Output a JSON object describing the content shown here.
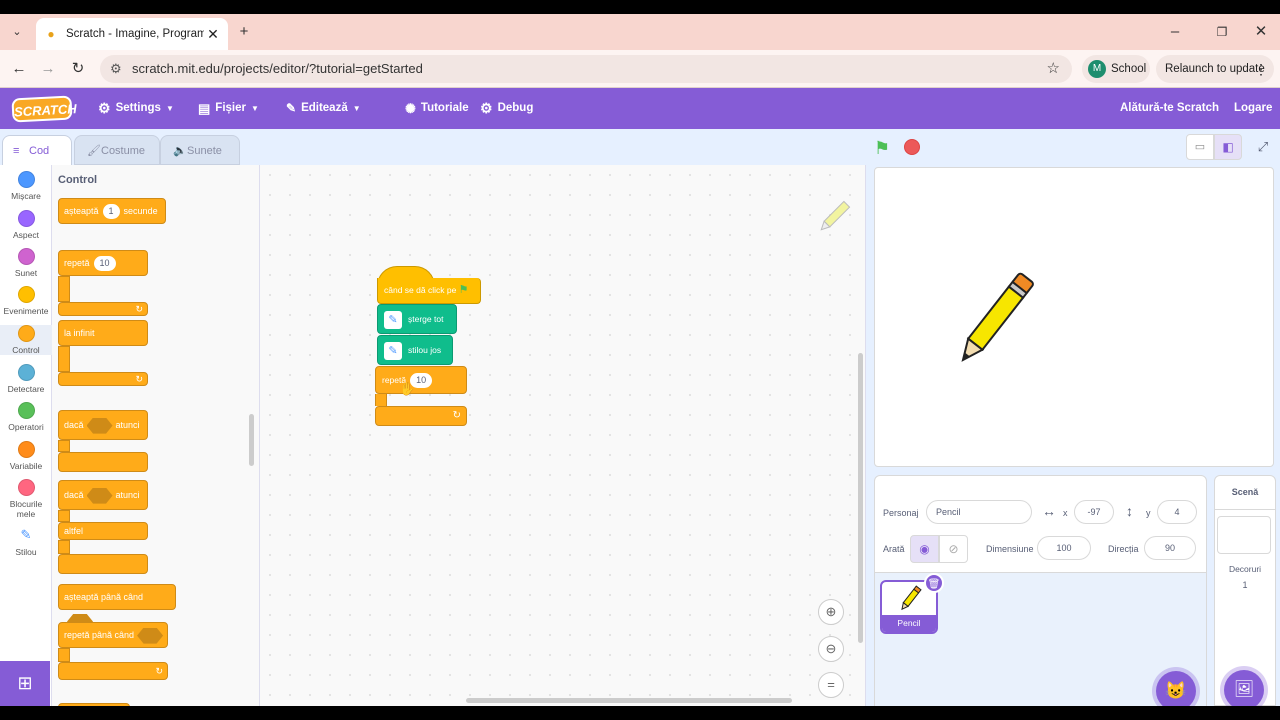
{
  "browser": {
    "tab_title": "Scratch - Imagine, Program, Sha",
    "url": "scratch.mit.edu/projects/editor/?tutorial=getStarted",
    "profile_initial": "M",
    "profile_label": "School",
    "relaunch_label": "Relaunch to update"
  },
  "menubar": {
    "logo": "SCRATCH",
    "settings": "Settings",
    "file": "Fișier",
    "edit": "Editează",
    "tutorials": "Tutoriale",
    "debug": "Debug",
    "join": "Alătură-te Scratch",
    "login": "Logare"
  },
  "editor_tabs": {
    "code": "Cod",
    "costumes": "Costume",
    "sounds": "Sunete"
  },
  "categories": [
    {
      "label": "Mișcare",
      "color": "#4c97ff"
    },
    {
      "label": "Aspect",
      "color": "#9966ff"
    },
    {
      "label": "Sunet",
      "color": "#cf63cf"
    },
    {
      "label": "Evenimente",
      "color": "#ffbf00"
    },
    {
      "label": "Control",
      "color": "#ffab19"
    },
    {
      "label": "Detectare",
      "color": "#5cb1d6"
    },
    {
      "label": "Operatori",
      "color": "#59c059"
    },
    {
      "label": "Variabile",
      "color": "#ff8c1a"
    },
    {
      "label": "Blocurile mele",
      "color": "#ff6680"
    },
    {
      "label": "Stilou",
      "color": "#0fbd8c"
    }
  ],
  "palette": {
    "heading": "Control",
    "wait": {
      "pre": "așteaptă",
      "num": "1",
      "post": "secunde"
    },
    "repeat": {
      "pre": "repetă",
      "num": "10"
    },
    "forever": "la infinit",
    "if_then": {
      "pre": "dacă",
      "post": "atunci"
    },
    "if_else": {
      "pre": "dacă",
      "post": "atunci",
      "else": "altfel"
    },
    "wait_until": "așteaptă până când",
    "repeat_until": "repetă până când"
  },
  "script": {
    "hat": "când se dă click pe",
    "clear": "șterge tot",
    "pen_down": "stilou jos",
    "repeat": {
      "pre": "repetă",
      "num": "10"
    }
  },
  "sprite_info": {
    "sprite_label": "Personaj",
    "sprite_name": "Pencil",
    "x_label": "x",
    "x_value": "-97",
    "y_label": "y",
    "y_value": "4",
    "show_label": "Arată",
    "size_label": "Dimensiune",
    "size_value": "100",
    "direction_label": "Direcția",
    "direction_value": "90",
    "sprite_thumb_name": "Pencil"
  },
  "stage_pane": {
    "title": "Scenă",
    "backdrops_label": "Decoruri",
    "backdrops_count": "1"
  },
  "colors": {
    "scratch_purple": "#855cd6",
    "control": "#ffab19",
    "pen": "#0fbd8c",
    "events": "#ffbf00"
  }
}
